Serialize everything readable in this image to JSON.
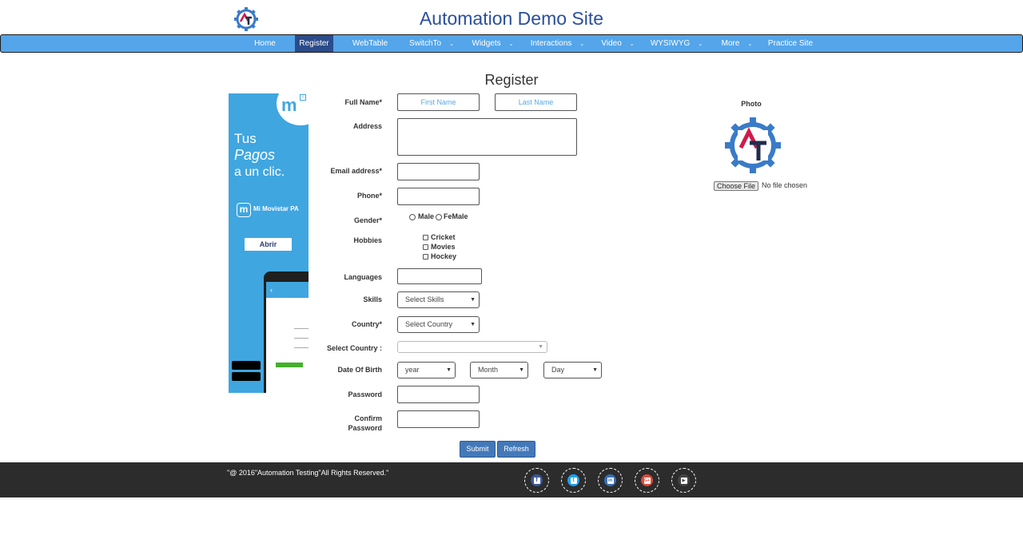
{
  "header": {
    "title": "Automation Demo Site"
  },
  "nav": {
    "items": [
      {
        "label": "Home",
        "dropdown": false
      },
      {
        "label": "Register",
        "dropdown": false,
        "active": true
      },
      {
        "label": "WebTable",
        "dropdown": false
      },
      {
        "label": "SwitchTo",
        "dropdown": true
      },
      {
        "label": "Widgets",
        "dropdown": true
      },
      {
        "label": "Interactions",
        "dropdown": true
      },
      {
        "label": "Video",
        "dropdown": true
      },
      {
        "label": "WYSIWYG",
        "dropdown": true
      },
      {
        "label": "More",
        "dropdown": true
      },
      {
        "label": "Practice Site",
        "dropdown": false
      }
    ],
    "caret": "chevron-down-icon"
  },
  "ad": {
    "line1": "Tus",
    "line2": "Pagos",
    "line3": "a un clic.",
    "brand": "Mi Movistar PA",
    "cta": "Abrir"
  },
  "form": {
    "title": "Register",
    "full_name_label": "Full Name*",
    "first_name_placeholder": "First Name",
    "last_name_placeholder": "Last Name",
    "address_label": "Address",
    "email_label": "Email address*",
    "phone_label": "Phone*",
    "gender_label": "Gender*",
    "gender_options": [
      "Male",
      "FeMale"
    ],
    "hobbies_label": "Hobbies",
    "hobbies_options": [
      "Cricket",
      "Movies",
      "Hockey"
    ],
    "languages_label": "Languages",
    "skills_label": "Skills",
    "skills_value": "Select Skills",
    "country_label": "Country*",
    "country_value": "Select Country",
    "select_country_label": "Select Country :",
    "select_country_value": "",
    "dob_label": "Date Of Birth",
    "dob_year": "year",
    "dob_month": "Month",
    "dob_day": "Day",
    "password_label": "Password",
    "confirm_password_label_1": "Confirm",
    "confirm_password_label_2": "Password",
    "submit_label": "Submit",
    "refresh_label": "Refresh"
  },
  "photo": {
    "label": "Photo",
    "choose_file": "Choose File",
    "no_file": "No file chosen"
  },
  "footer": {
    "copyright": "\"@ 2016\"Automation Testing\"All Rights Reserved.\"",
    "social": [
      {
        "name": "facebook-icon",
        "color": "#3b5998",
        "glyph": "f"
      },
      {
        "name": "twitter-icon",
        "color": "#1da1f2",
        "glyph": "t"
      },
      {
        "name": "linkedin-icon",
        "color": "#3a6fb5",
        "glyph": "in"
      },
      {
        "name": "google-plus-icon",
        "color": "#dd4b39",
        "glyph": "G+"
      },
      {
        "name": "youtube-icon",
        "color": "#444444",
        "glyph": "▶"
      }
    ]
  },
  "colors": {
    "nav_bg": "#54a5e9",
    "nav_active": "#2b4c8a",
    "button": "#4479b9",
    "title": "#2a4f9c",
    "footer": "#2c2c2c"
  }
}
